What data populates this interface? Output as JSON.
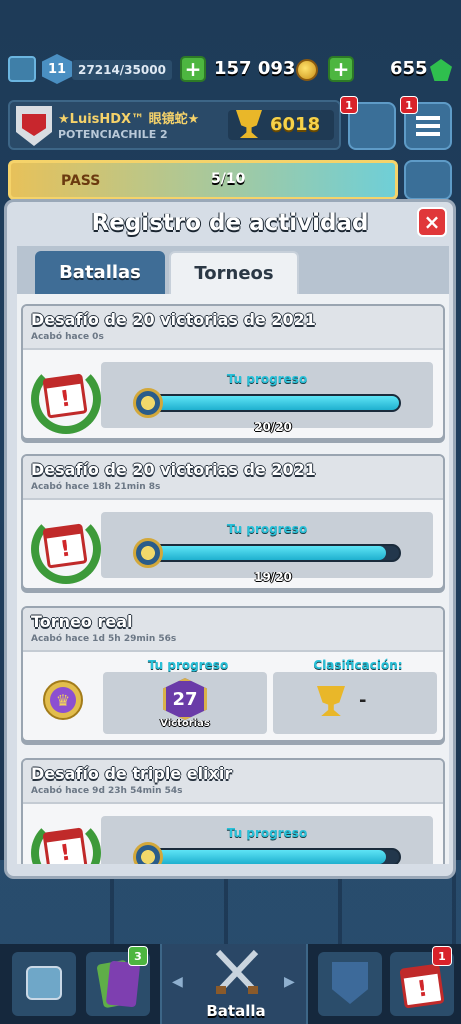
{
  "topbar": {
    "level": "11",
    "xp": "27214/35000",
    "gold": "157 093",
    "gems": "655"
  },
  "profile": {
    "name": "★LuisHDX™ 眼镜蛇★",
    "clan": "POTENCIACHILE 2",
    "trophies": "6018",
    "friends_badge": "1",
    "menu_badge": "1"
  },
  "pass": {
    "label": "PASS",
    "progress": "5/10"
  },
  "modal": {
    "title": "Registro de actividad",
    "close": "×",
    "tabs": [
      "Batallas",
      "Torneos"
    ]
  },
  "cards": [
    {
      "title": "Desafío de 20 victorias de 2021",
      "ended": "Acabó hace 0s",
      "progress_label": "Tu progreso",
      "progress_text": "20/20",
      "progress": 1.0
    },
    {
      "title": "Desafío de 20 victorias de 2021",
      "ended": "Acabó hace 18h 21min  8s",
      "progress_label": "Tu progreso",
      "progress_text": "19/20",
      "progress": 0.95
    },
    {
      "title": "Torneo real",
      "ended": "Acabó hace 1d 5h 29min  56s",
      "progress_label": "Tu progreso",
      "wins": "27",
      "wins_label": "Victorias",
      "rank_label": "Clasificación:",
      "rank_value": "-"
    },
    {
      "title": "Desafío de triple elixir",
      "ended": "Acabó hace 9d 23h 54min  54s",
      "progress_label": "Tu progreso",
      "progress": 0.95
    }
  ],
  "bottom_nav": {
    "cards_badge": "3",
    "battle_label": "Batalla",
    "events_badge": "1",
    "arrow_left": "◀",
    "arrow_right": "▶"
  },
  "colors": {
    "accent_cyan": "#28c1d9",
    "close_red": "#e0373a",
    "plus_green": "#4db640"
  }
}
